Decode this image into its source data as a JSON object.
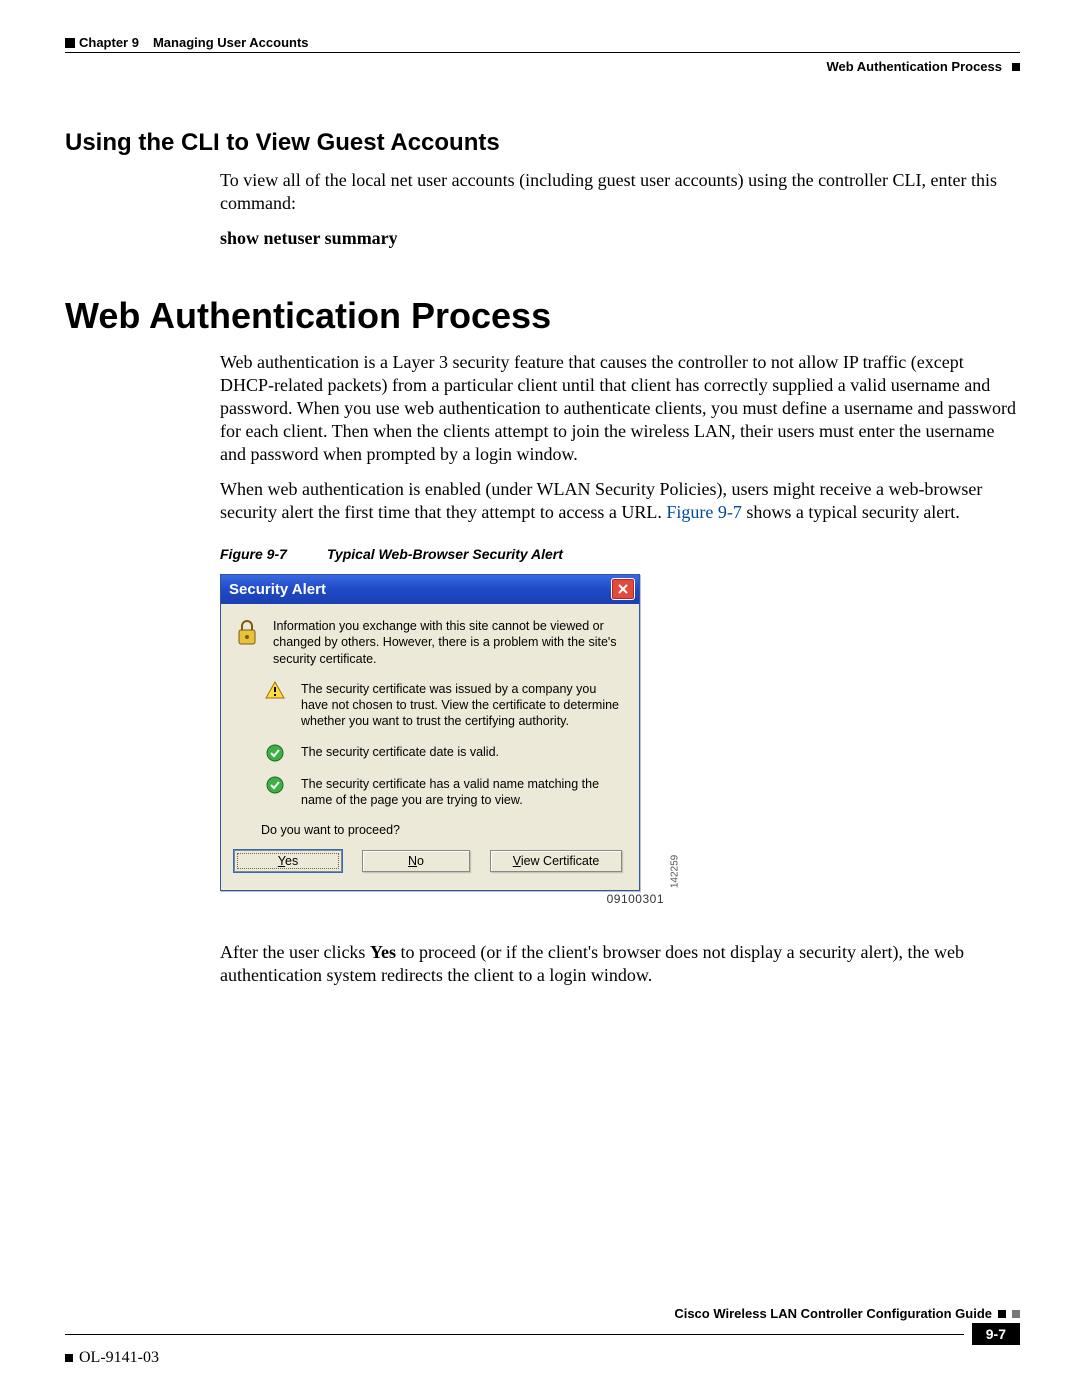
{
  "header": {
    "chapter": "Chapter 9",
    "chapter_title": "Managing User Accounts",
    "section_right": "Web Authentication Process"
  },
  "sub_heading": "Using the CLI to View Guest Accounts",
  "cli_intro": "To view all of the local net user accounts (including guest user accounts) using the controller CLI, enter this command:",
  "cli_cmd": "show netuser summary",
  "main_heading": "Web Authentication Process",
  "para1": "Web authentication is a Layer 3 security feature that causes the controller to not allow IP traffic (except DHCP-related packets) from a particular client until that client has correctly supplied a valid username and password. When you use web authentication to authenticate clients, you must define a username and password for each client. Then when the clients attempt to join the wireless LAN, their users must enter the username and password when prompted by a login window.",
  "para2a": "When web authentication is enabled (under WLAN Security Policies), users might receive a web-browser security alert the first time that they attempt to access a URL. ",
  "para2_link": "Figure 9-7",
  "para2b": " shows a typical security alert.",
  "fig_caption_label": "Figure 9-7",
  "fig_caption_text": "Typical Web-Browser Security Alert",
  "dialog": {
    "title": "Security Alert",
    "row_lock": "Information you exchange with this site cannot be viewed or changed by others. However, there is a problem with the site's security certificate.",
    "row_warn": "The security certificate was issued by a company you have not chosen to trust. View the certificate to determine whether you want to trust the certifying authority.",
    "row_ok1": "The security certificate date is valid.",
    "row_ok2": "The security certificate has a valid name matching the name of the page you are trying to view.",
    "proceed": "Do you want to proceed?",
    "btn_yes": "Yes",
    "btn_no": "No",
    "btn_view": "View Certificate",
    "side_num": "142259",
    "below_num": "09100301"
  },
  "after_para_a": "After the user clicks ",
  "after_para_bold": "Yes",
  "after_para_b": " to proceed (or if the client's browser does not display a security alert), the web authentication system redirects the client to a login window.",
  "footer": {
    "guide": "Cisco Wireless LAN Controller Configuration Guide",
    "doc_id": "OL-9141-03",
    "page_num": "9-7"
  }
}
